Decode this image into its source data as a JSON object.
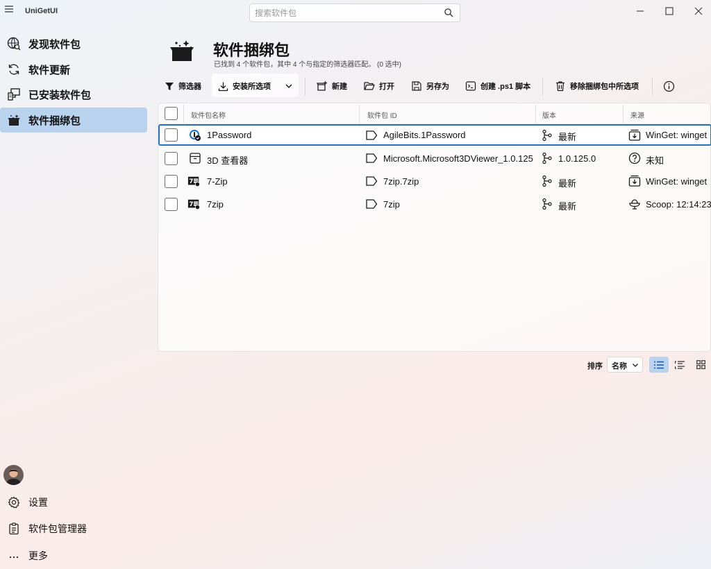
{
  "app": {
    "name": "UniGetUI"
  },
  "search": {
    "placeholder": "搜索软件包"
  },
  "sidebar": {
    "items": [
      {
        "label": "发现软件包"
      },
      {
        "label": "软件更新"
      },
      {
        "label": "已安装软件包"
      },
      {
        "label": "软件捆绑包"
      }
    ],
    "bottom": [
      {
        "label": "设置"
      },
      {
        "label": "软件包管理器"
      },
      {
        "label": "更多"
      }
    ],
    "active_item": "软件捆绑包"
  },
  "header": {
    "title": "软件捆绑包",
    "subtitle": "已找到 4 个软件包，其中 4 个与指定的筛选器匹配。 (0 选中)"
  },
  "toolbar": {
    "filter": "筛选器",
    "install_selected": "安装所选项",
    "new": "新建",
    "open": "打开",
    "save_as": "另存为",
    "create_ps1": "创建 .ps1 脚本",
    "remove_selected": "移除捆绑包中所选项"
  },
  "table": {
    "columns": [
      "软件包名称",
      "软件包 ID",
      "版本",
      "来源"
    ],
    "rows": [
      {
        "name": "1Password",
        "id": "AgileBits.1Password",
        "version": "最新",
        "source": "WinGet: winget",
        "icon": "1password-icon",
        "source_icon": "winget-icon"
      },
      {
        "name": "3D 查看器",
        "id": "Microsoft.Microsoft3DViewer_1.0.125",
        "version": "1.0.125.0",
        "source": "未知",
        "icon": "package-box-icon",
        "source_icon": "question-icon"
      },
      {
        "name": "7-Zip",
        "id": "7zip.7zip",
        "version": "最新",
        "source": "WinGet: winget",
        "icon": "7zip-icon",
        "source_icon": "winget-icon"
      },
      {
        "name": "7zip",
        "id": "7zip",
        "version": "最新",
        "source": "Scoop: 12:14:23",
        "icon": "7zip-icon",
        "source_icon": "scoop-icon"
      }
    ]
  },
  "footer": {
    "sort_label": "排序",
    "sort_value": "名称"
  },
  "colors": {
    "accent": "#2b6fbf",
    "active_nav": "#b9d3ee"
  }
}
